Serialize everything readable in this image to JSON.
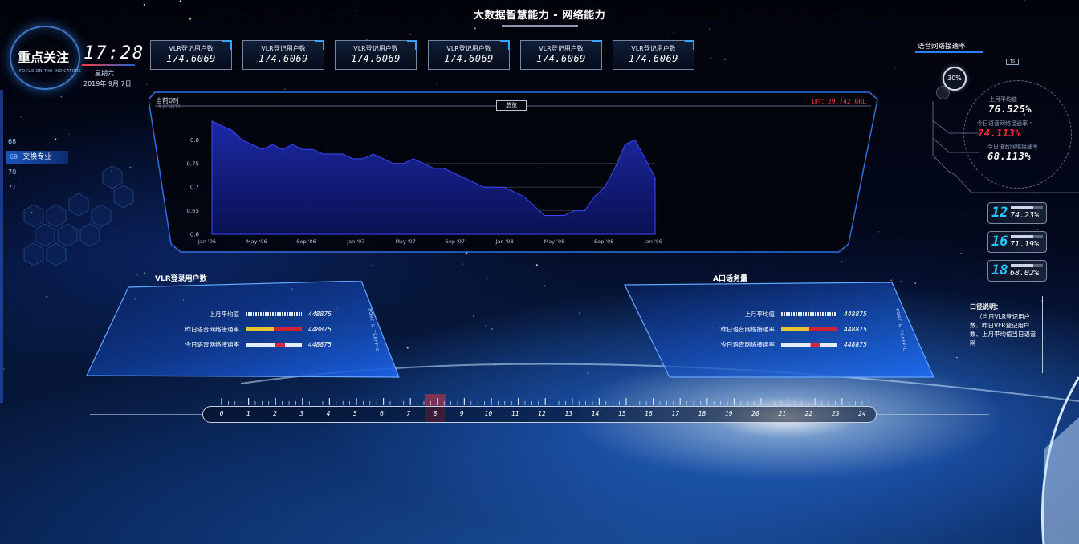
{
  "page": {
    "title": "大数据智慧能力 - 网络能力"
  },
  "focus": {
    "title": "重点关注",
    "subtitle": "FOCUS ON THE INDICATORS",
    "time": "17:28",
    "weekday": "星期六",
    "date": "2019年 9月 7日"
  },
  "kpis": [
    {
      "label": "VLR登记用户数",
      "value": "174.6069"
    },
    {
      "label": "VLR登记用户数",
      "value": "174.6069"
    },
    {
      "label": "VLR登记用户数",
      "value": "174.6069"
    },
    {
      "label": "VLR登记用户数",
      "value": "174.6069"
    },
    {
      "label": "VLR登记用户数",
      "value": "174.6069"
    },
    {
      "label": "VLR登记用户数",
      "value": "174.6069"
    }
  ],
  "chart": {
    "left_label": "当前0时",
    "left_sub": "8 POINTS",
    "tab_label": "总览",
    "right_label": "1时：29.742.6RL"
  },
  "chart_data": {
    "type": "area",
    "x_ticks": [
      "Jan '06",
      "May '06",
      "Sep '06",
      "Jan '07",
      "May '07",
      "Sep '07",
      "Jan '08",
      "May '08",
      "Sep '08",
      "Jan '09"
    ],
    "y_ticks": [
      "0.6",
      "0.65",
      "0.7",
      "0.75",
      "0.8"
    ],
    "ylim": [
      0.6,
      0.85
    ],
    "grid": true,
    "series": [
      {
        "values": [
          0.84,
          0.83,
          0.82,
          0.8,
          0.79,
          0.78,
          0.79,
          0.78,
          0.79,
          0.78,
          0.78,
          0.77,
          0.77,
          0.77,
          0.76,
          0.76,
          0.77,
          0.76,
          0.75,
          0.75,
          0.76,
          0.75,
          0.74,
          0.74,
          0.73,
          0.72,
          0.71,
          0.7,
          0.7,
          0.7,
          0.69,
          0.68,
          0.66,
          0.64,
          0.64,
          0.64,
          0.65,
          0.65,
          0.68,
          0.7,
          0.74,
          0.79,
          0.8,
          0.76,
          0.72
        ]
      }
    ]
  },
  "nav": {
    "items": [
      "68",
      "69",
      "70",
      "71"
    ],
    "active_label": "交换专业"
  },
  "vlr_panel": {
    "title": "VLR登录用户数",
    "vertical_label": "PORT & TRAFFIC",
    "rows": [
      {
        "label": "上月平均值",
        "value": "448875"
      },
      {
        "label": "昨日语音网络接通率",
        "value": "448875"
      },
      {
        "label": "今日语音网络接通率",
        "value": "448875"
      }
    ]
  },
  "a_panel": {
    "title": "A口话务量",
    "vertical_label": "PORT & TRAFFIC",
    "rows": [
      {
        "label": "上月平均值",
        "value": "448875"
      },
      {
        "label": "昨日语音网络接通率",
        "value": "448875"
      },
      {
        "label": "今日语音网络接通率",
        "value": "448875"
      }
    ]
  },
  "right": {
    "title": "语音网络接通率",
    "tag": "TS",
    "ring_pct": "30%",
    "metrics": [
      {
        "label": "上月平均值",
        "value": "76.525%"
      },
      {
        "label": "今日语音网络接通率",
        "value": "74.113%"
      },
      {
        "label": "今日语音网络接通率",
        "value": "68.113%"
      }
    ],
    "cards": [
      {
        "num": "12",
        "pct": "74.23%"
      },
      {
        "num": "16",
        "pct": "71.19%"
      },
      {
        "num": "18",
        "pct": "68.02%"
      }
    ],
    "note_title": "口径说明：",
    "note_body": "（当日VLR登记用户数、昨日VLR登记用户数、上月平均值当日语音网"
  },
  "timeline": {
    "labels": [
      "0",
      "1",
      "2",
      "3",
      "4",
      "5",
      "6",
      "7",
      "8",
      "9",
      "10",
      "11",
      "12",
      "13",
      "14",
      "15",
      "16",
      "17",
      "18",
      "19",
      "20",
      "21",
      "22",
      "23",
      "24"
    ],
    "active": "8"
  },
  "colors": {
    "accent": "#37a4ff",
    "red": "#ff2d3a",
    "cyan": "#24c6ff",
    "yellow": "#e8c431"
  }
}
